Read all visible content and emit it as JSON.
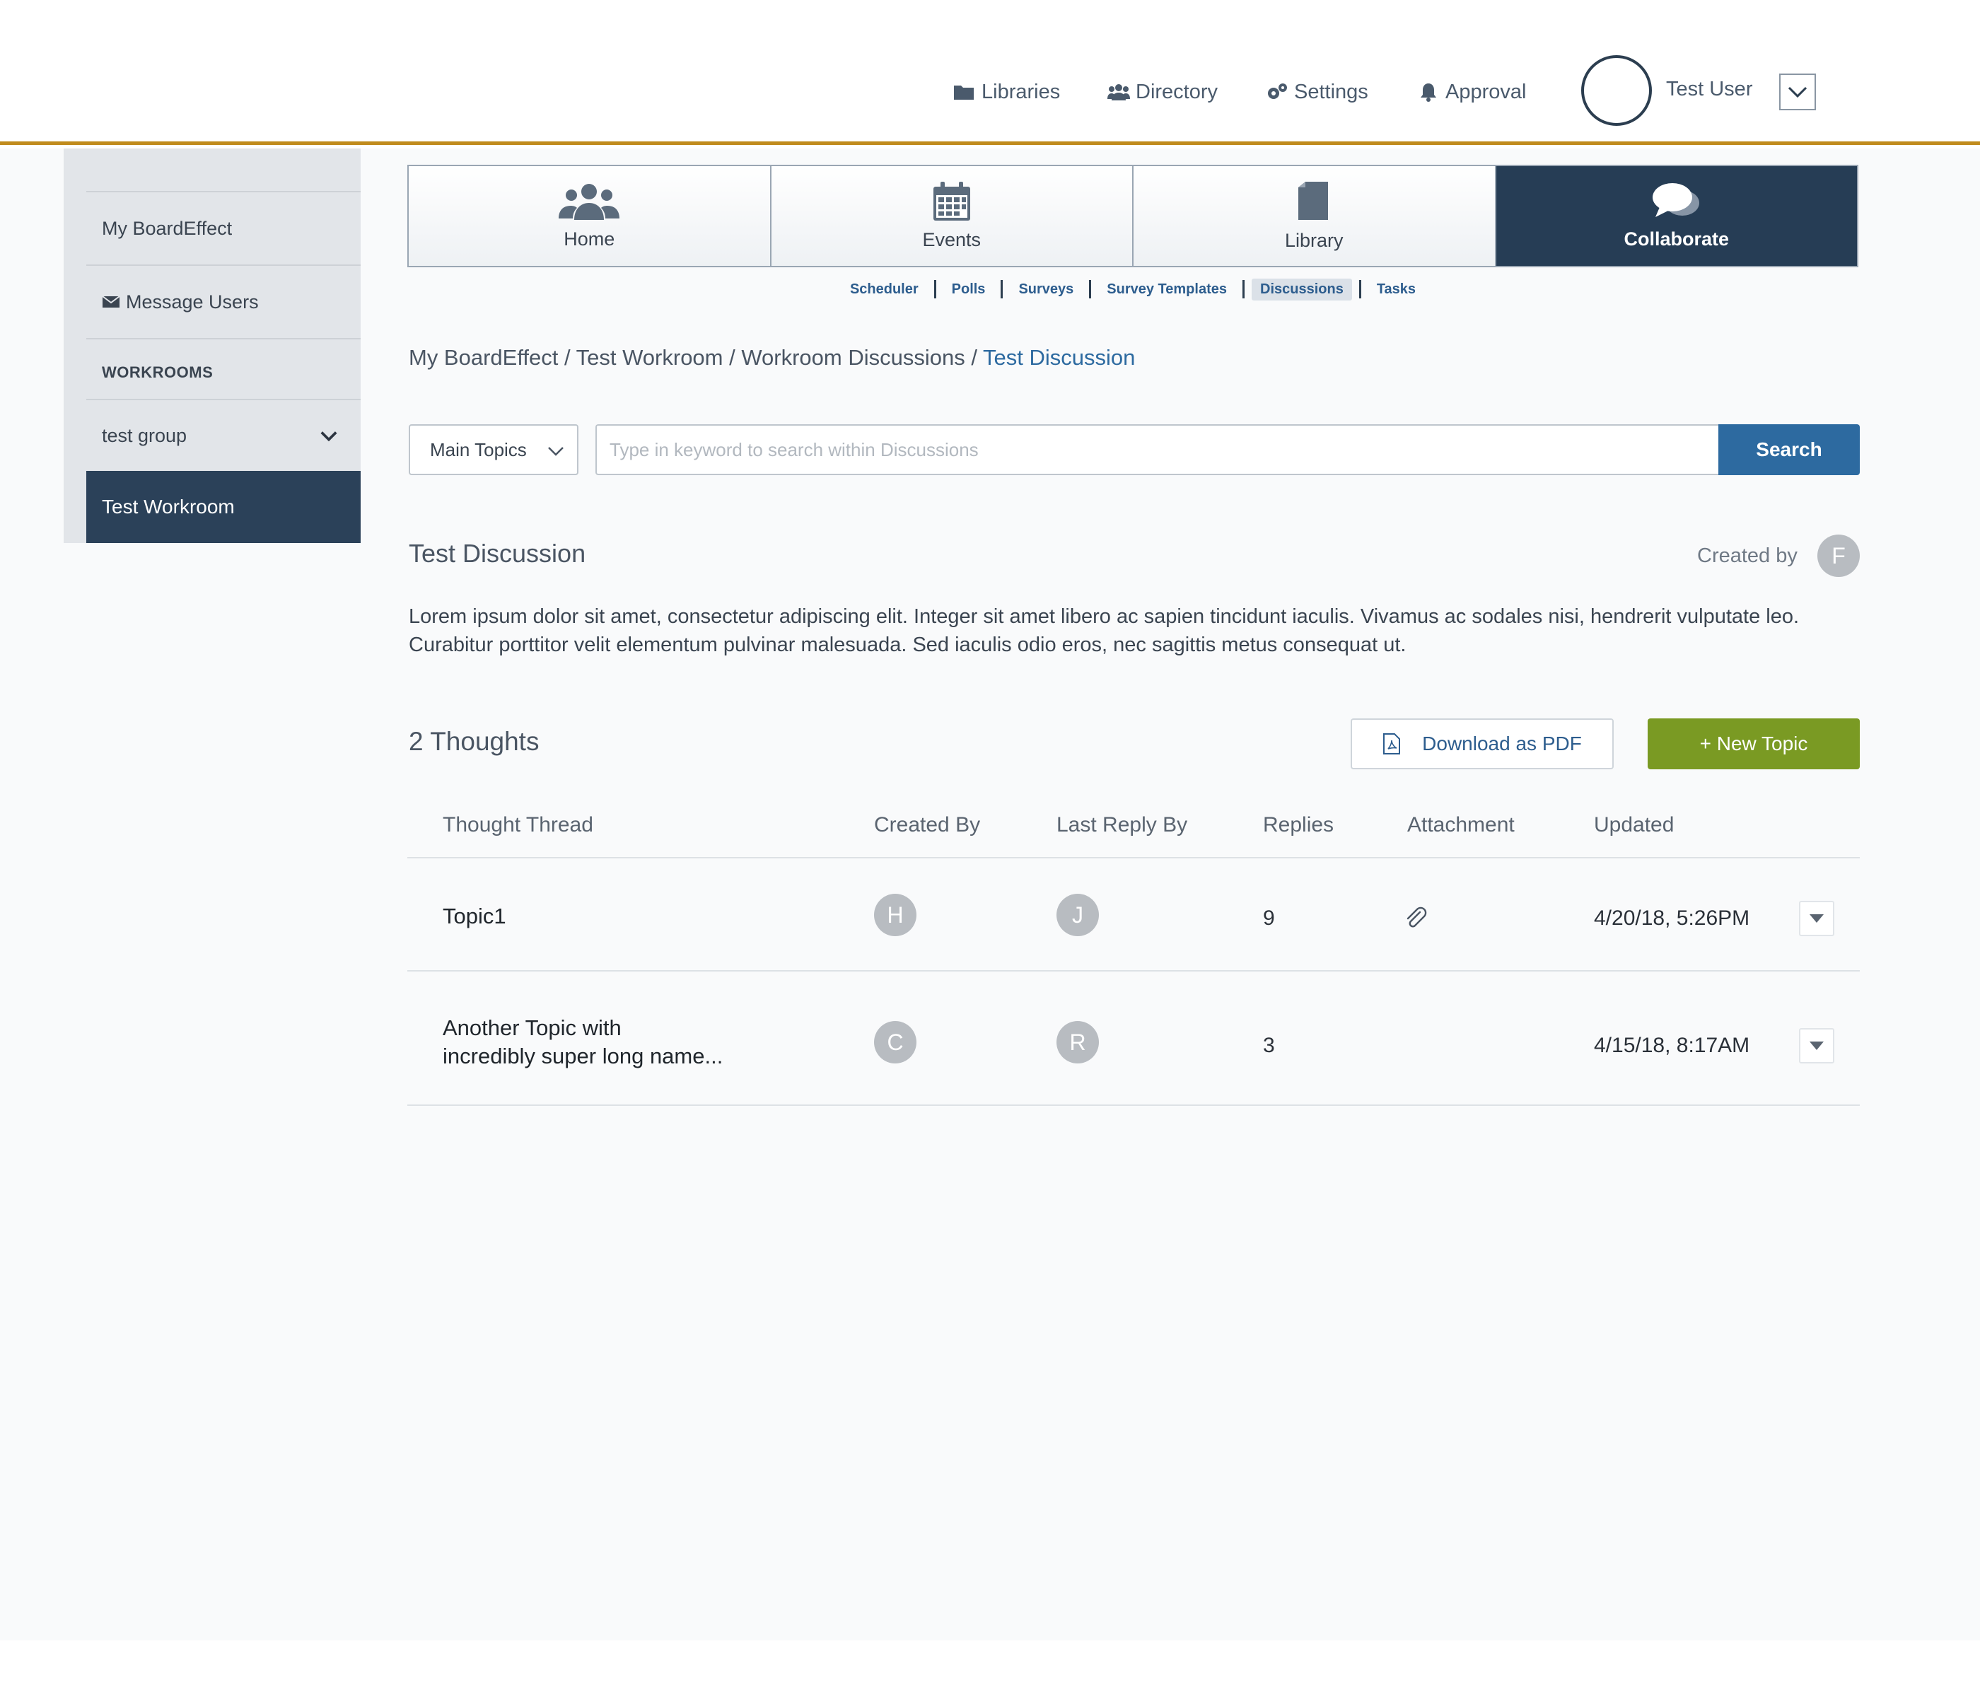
{
  "topnav": {
    "libraries": "Libraries",
    "directory": "Directory",
    "settings": "Settings",
    "approval": "Approval",
    "user_name": "Test User"
  },
  "sidebar": {
    "my_boardeffect": "My BoardEffect",
    "message_users": "Message Users",
    "workrooms_heading": "WORKROOMS",
    "group": "test group",
    "active_workroom": "Test Workroom"
  },
  "tabs": [
    {
      "label": "Home",
      "icon": "users-icon"
    },
    {
      "label": "Events",
      "icon": "calendar-icon"
    },
    {
      "label": "Library",
      "icon": "document-icon"
    },
    {
      "label": "Collaborate",
      "icon": "chat-bubbles-icon",
      "active": true
    }
  ],
  "subnav": [
    "Scheduler",
    "Polls",
    "Surveys",
    "Survey Templates",
    "Discussions",
    "Tasks"
  ],
  "subnav_active": "Discussions",
  "breadcrumb": {
    "items": [
      "My BoardEffect",
      "Test Workroom",
      "Workroom Discussions"
    ],
    "separator": " / ",
    "current": "Test Discussion"
  },
  "search": {
    "filter_value": "Main Topics",
    "placeholder": "Type in keyword to search within Discussions",
    "button": "Search"
  },
  "discussion": {
    "title": "Test Discussion",
    "created_by_label": "Created by",
    "created_by_initial": "F",
    "description": "Lorem ipsum dolor sit amet, consectetur adipiscing elit. Integer sit amet libero ac sapien tincidunt iaculis. Vivamus ac sodales nisi, hendrerit vulputate leo. Curabitur porttitor velit elementum pulvinar malesuada. Sed iaculis odio eros, nec sagittis metus consequat ut."
  },
  "thoughts": {
    "count_label": "2 Thoughts",
    "download_pdf": "Download as PDF",
    "new_topic": "+ New Topic",
    "columns": [
      "Thought Thread",
      "Created By",
      "Last Reply By",
      "Replies",
      "Attachment",
      "Updated"
    ],
    "rows": [
      {
        "title_line1": "Topic1",
        "title_line2": "",
        "created_by": "H",
        "last_reply_by": "J",
        "replies": "9",
        "attachment": true,
        "updated": "4/20/18, 5:26PM"
      },
      {
        "title_line1": "Another Topic with",
        "title_line2": "incredibly super long name...",
        "created_by": "C",
        "last_reply_by": "R",
        "replies": "3",
        "attachment": false,
        "updated": "4/15/18, 8:17AM"
      }
    ]
  },
  "colors": {
    "accent_gold": "#c08b1d",
    "navy": "#263d55",
    "link_blue": "#2d6aa0",
    "green": "#7a9a23"
  }
}
